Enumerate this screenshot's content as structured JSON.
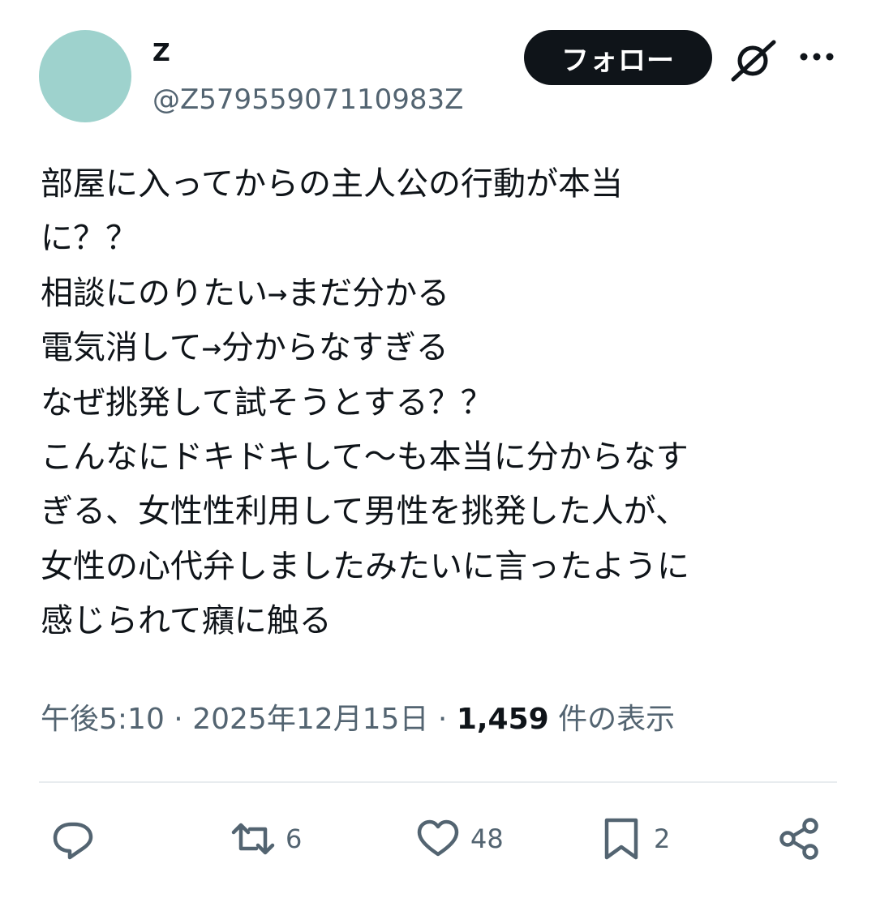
{
  "user": {
    "display_name": "Z",
    "handle": "@Z57955907110983Z"
  },
  "header": {
    "follow_label": "フォロー",
    "grok_icon": "grok-icon",
    "more_icon": "more-icon"
  },
  "tweet": {
    "lines": [
      "部屋に入ってからの主人公の行動が本当",
      "に？？",
      "相談にのりたい→まだ分かる",
      "電気消して→分からなすぎる",
      "なぜ挑発して試そうとする？？",
      "こんなにドキドキして〜も本当に分からなす",
      "ぎる、女性性利用して男性を挑発した人が、",
      "女性の心代弁しましたみたいに言ったように",
      "感じられて癪に触る"
    ]
  },
  "meta": {
    "time": "午後5:10",
    "separator": "·",
    "date": "2025年12月15日",
    "views_count": "1,459",
    "views_label": "件の表示"
  },
  "actions": {
    "reply_icon": "reply-icon",
    "retweet_icon": "retweet-icon",
    "retweet_count": "6",
    "like_icon": "heart-icon",
    "like_count": "48",
    "bookmark_icon": "bookmark-icon",
    "bookmark_count": "2",
    "share_icon": "share-icon"
  },
  "colors": {
    "avatar": "#9ed2cd",
    "text_primary": "#0f1419",
    "text_secondary": "#536471",
    "divider": "#e8ecef"
  }
}
